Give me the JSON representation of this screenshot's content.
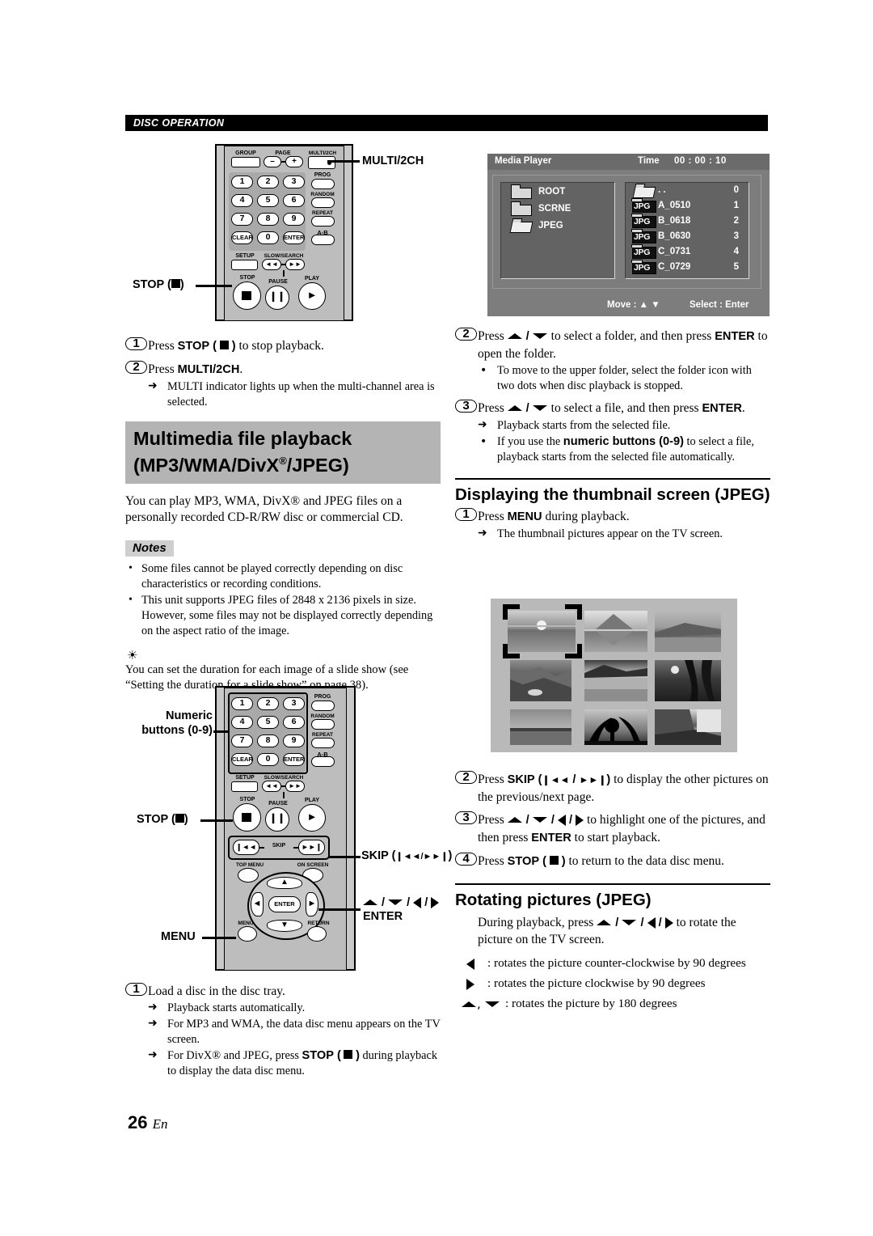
{
  "header": {
    "section": "DISC OPERATION"
  },
  "page_number": {
    "num": "26",
    "lang": "En"
  },
  "left": {
    "step1": {
      "num": "1",
      "pre": "Press ",
      "bold": "STOP",
      "paren_open": "(",
      "paren_close": ")",
      "post": " to stop playback."
    },
    "step2": {
      "num": "2",
      "pre": "Press ",
      "bold": "MULTI/2CH",
      "post": "."
    },
    "step2_sub": "MULTI indicator lights up when the multi-channel area is selected.",
    "section_heading_line1": "Multimedia file playback",
    "section_heading_line2_a": "(MP3/WMA/DivX",
    "section_heading_reg": "®",
    "section_heading_line2_b": "/JPEG)",
    "intro": "You can play MP3, WMA, DivX® and JPEG files on a personally recorded CD-R/RW disc or commercial CD.",
    "notes_label": "Notes",
    "notes": [
      "Some files cannot be played correctly depending on disc characteristics or recording conditions.",
      "This unit supports JPEG files of 2848 x 2136 pixels in size. However, some files may not be displayed correctly depending on the aspect ratio of the image."
    ],
    "tip": "You can set the duration for each image of a slide show (see “Setting the duration for a slide show” on page 38).",
    "load_step": {
      "num": "1",
      "text": "Load a disc in the disc tray."
    },
    "load_subs": [
      "Playback starts automatically.",
      "For MP3 and WMA, the data disc menu appears on the TV screen."
    ],
    "load_sub3": {
      "pre": "For DivX® and JPEG, press ",
      "bold": "STOP",
      "paren_open": "(",
      "paren_close": ")",
      "post": " during playback to display the data disc menu."
    }
  },
  "remote_top": {
    "callout_multi": "MULTI/2CH",
    "callout_stop": "STOP (",
    "callout_stop_end": ")",
    "labels": {
      "group": "GROUP",
      "page": "PAGE",
      "multi2ch": "MULTI/2CH",
      "prog": "PROG",
      "random": "RANDOM",
      "repeat": "REPEAT",
      "ab": "A-B",
      "setup": "SETUP",
      "slow_search": "SLOW/SEARCH",
      "stop": "STOP",
      "pause": "PAUSE",
      "play": "PLAY",
      "minus": "–",
      "plus": "+",
      "clear": "CLEAR",
      "zero": "0",
      "enter": "ENTER"
    },
    "numbers": [
      "1",
      "2",
      "3",
      "4",
      "5",
      "6",
      "7",
      "8",
      "9"
    ]
  },
  "remote_bottom": {
    "callout_numeric_l1": "Numeric",
    "callout_numeric_l2": "buttons (0-9)",
    "callout_stop": "STOP (",
    "callout_stop_end": ")",
    "callout_skip": "SKIP (",
    "callout_skip_end": ")",
    "callout_enter": "ENTER",
    "labels": {
      "prog": "PROG",
      "random": "RANDOM",
      "repeat": "REPEAT",
      "ab": "A-B",
      "setup": "SETUP",
      "slow_search": "SLOW/SEARCH",
      "stop": "STOP",
      "pause": "PAUSE",
      "play": "PLAY",
      "skip": "SKIP",
      "top_menu": "TOP MENU",
      "on_screen": "ON SCREEN",
      "menu": "MENU",
      "return": "RETURN",
      "enter": "ENTER",
      "clear": "CLEAR",
      "zero": "0",
      "enter_key": "ENTER"
    },
    "numbers": [
      "1",
      "2",
      "3",
      "4",
      "5",
      "6",
      "7",
      "8",
      "9"
    ]
  },
  "osd": {
    "title": "Media Player",
    "time_label": "Time",
    "time_value": "00 : 00 : 10",
    "folders": [
      {
        "name": "ROOT",
        "icon": "folder-icon"
      },
      {
        "name": "SCRNE",
        "icon": "folder-icon"
      },
      {
        "name": "JPEG",
        "icon": "folder-open-icon"
      }
    ],
    "files": [
      {
        "name": ". .",
        "index": "0",
        "icon": "folder-open-icon",
        "type": ""
      },
      {
        "name": "A_0510",
        "index": "1",
        "icon": "jpg-file-icon",
        "type": "JPG"
      },
      {
        "name": "B_0618",
        "index": "2",
        "icon": "jpg-file-icon",
        "type": "JPG"
      },
      {
        "name": "B_0630",
        "index": "3",
        "icon": "jpg-file-icon",
        "type": "JPG"
      },
      {
        "name": "C_0731",
        "index": "4",
        "icon": "jpg-file-icon",
        "type": "JPG"
      },
      {
        "name": "C_0729",
        "index": "5",
        "icon": "jpg-file-icon",
        "type": "JPG"
      }
    ],
    "footer_move": "Move : ▲ ▼",
    "footer_select": "Select : Enter"
  },
  "right": {
    "step2": {
      "num": "2",
      "a": "Press ",
      "b": " / ",
      "c": " to select a folder, and then press ",
      "bold": "ENTER",
      "d": " to open the folder."
    },
    "step2_sub": "To move to the upper folder, select the folder icon with two dots when disc playback is stopped.",
    "step3": {
      "num": "3",
      "a": "Press ",
      "b": " / ",
      "c": " to select a file, and then press ",
      "bold": "ENTER",
      "d": "."
    },
    "step3_sub_arrow": "Playback starts from the selected file.",
    "step3_sub_dot": {
      "a": "If you use the ",
      "bold": "numeric buttons (0-9)",
      "b": " to select a file, playback starts from the selected file automatically."
    },
    "thumb_heading": "Displaying the thumbnail screen (JPEG)",
    "thumb_step1": {
      "num": "1",
      "a": "Press ",
      "bold": "MENU",
      "b": " during playback."
    },
    "thumb_step1_sub": "The thumbnail pictures appear on the TV screen.",
    "thumb_step2": {
      "num": "2",
      "a": "Press ",
      "bold": "SKIP",
      "paren_open": "(",
      "slash": " / ",
      "paren_close": ")",
      "b": " to display the other pictures on the previous/next page."
    },
    "thumb_step3": {
      "num": "3",
      "a": "Press ",
      "b": " to highlight one of the pictures, and then press ",
      "bold": "ENTER",
      "c": " to start playback."
    },
    "thumb_step4": {
      "num": "4",
      "a": "Press ",
      "bold": "STOP",
      "paren_open": "(",
      "paren_close": ")",
      "b": " to return to the data disc menu."
    },
    "rotate_heading": "Rotating pictures (JPEG)",
    "rotate_intro_a": "During playback, press ",
    "rotate_intro_b": " to rotate the picture on the TV screen.",
    "rotate_left": ": rotates the picture counter-clockwise by 90 degrees",
    "rotate_right": ": rotates the picture clockwise by 90 degrees",
    "rotate_180": ": rotates the picture by 180 degrees"
  },
  "thumbnails": {
    "selected_index": 0,
    "cells": [
      {
        "alt": "sunset-over-lake"
      },
      {
        "alt": "mountain-reflection"
      },
      {
        "alt": "green-hills-lake"
      },
      {
        "alt": "rocky-coastline"
      },
      {
        "alt": "shoreline-dunes"
      },
      {
        "alt": "sun-through-trees"
      },
      {
        "alt": "clouds-over-sea"
      },
      {
        "alt": "palm-trees"
      },
      {
        "alt": "cliff-over-river"
      }
    ]
  },
  "colors": {
    "accent_gray": "#b4b4b4",
    "header_bar": "#000000",
    "osd_bg": "#7d7d7d"
  }
}
